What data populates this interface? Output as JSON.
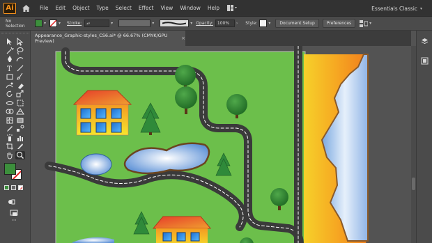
{
  "app": {
    "logo_text": "Ai",
    "workspace": "Essentials Classic"
  },
  "menu": [
    "File",
    "Edit",
    "Object",
    "Type",
    "Select",
    "Effect",
    "View",
    "Window",
    "Help"
  ],
  "control_bar": {
    "selection_label": "No Selection",
    "stroke_label": "Stroke:",
    "opacity_label": "Opacity:",
    "opacity_value": "100%",
    "style_label": "Style:",
    "document_setup_label": "Document Setup",
    "preferences_label": "Preferences",
    "fill_color": "#3c8f3c"
  },
  "document_tab": {
    "title": "Appearance_Graphic-styles_CS6.ai* @ 66.67% (CMYK/GPU Preview)",
    "close_glyph": "×"
  },
  "tools": [
    "selection-tool",
    "direct-selection-tool",
    "magic-wand-tool",
    "lasso-tool",
    "pen-tool",
    "curvature-tool",
    "type-tool",
    "line-segment-tool",
    "rectangle-tool",
    "paintbrush-tool",
    "shaper-tool",
    "eraser-tool",
    "rotate-tool",
    "scale-tool",
    "width-tool",
    "free-transform-tool",
    "shape-builder-tool",
    "perspective-grid-tool",
    "mesh-tool",
    "gradient-tool",
    "eyedropper-tool",
    "blend-tool",
    "symbol-sprayer-tool",
    "column-graph-tool",
    "artboard-tool",
    "slice-tool",
    "hand-tool",
    "zoom-tool"
  ],
  "colors": {
    "grass": "#6cbf4b",
    "road": "#3a3a3a",
    "road_line": "#ffffff",
    "water": "#8fb8e6",
    "sand": "#f5b324",
    "tree": "#2f7d2f",
    "house_wall_top": "#f0a020",
    "house_wall_bottom": "#f5e02a",
    "roof": "#e84a2a",
    "window": "#2f8be0"
  }
}
